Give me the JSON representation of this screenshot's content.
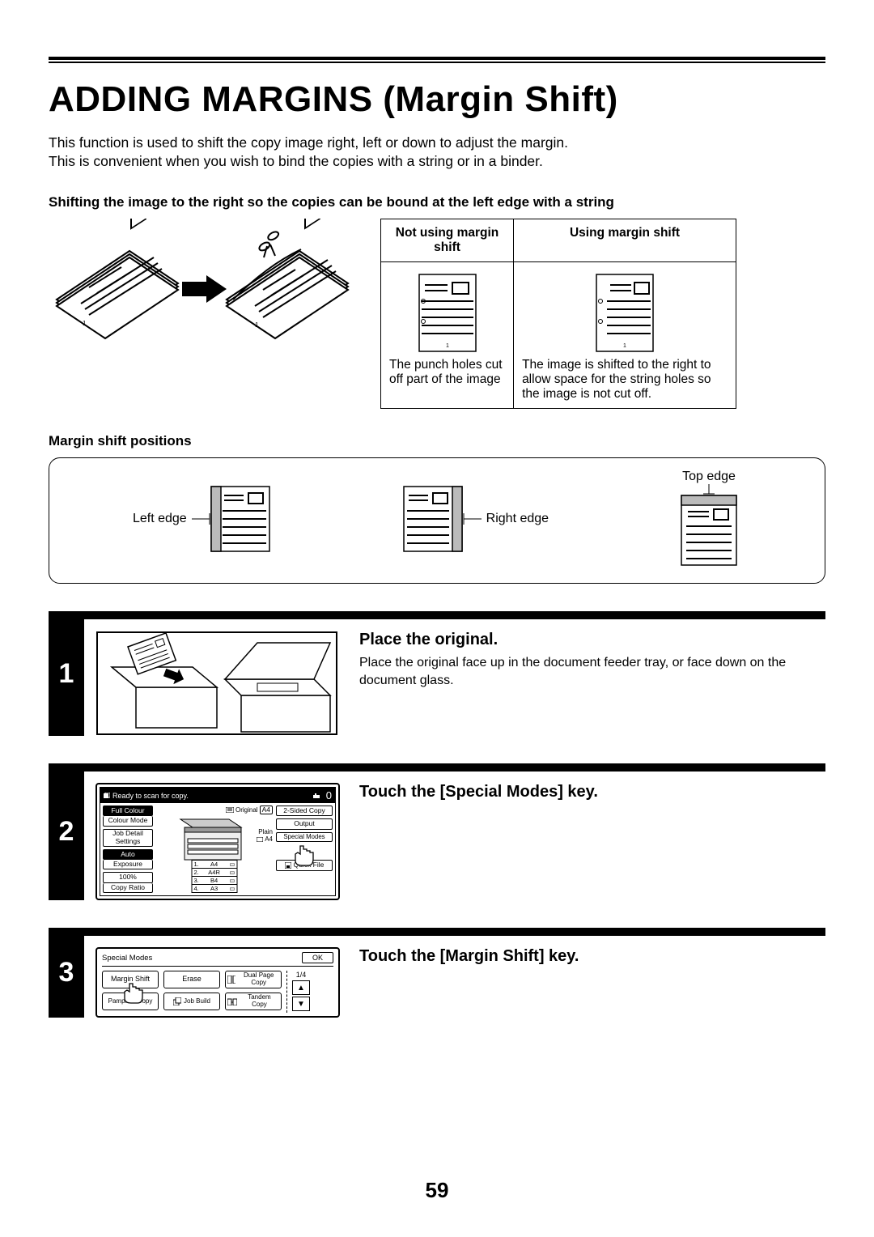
{
  "title": "ADDING MARGINS (Margin Shift)",
  "intro1": "This function is used to shift the copy image right, left or down to adjust the margin.",
  "intro2": "This is convenient when you wish to bind the copies with a string or in a binder.",
  "subhead1": "Shifting the image to the right so the copies can be bound at the left edge with a string",
  "table": {
    "h1": "Not using margin shift",
    "h2": "Using margin shift",
    "c1": "The punch holes cut off part of the image",
    "c2": "The image is shifted to the right to allow space for the string holes so the image is not cut off."
  },
  "pos_heading": "Margin shift positions",
  "pos": {
    "left": "Left edge",
    "right": "Right edge",
    "top": "Top edge"
  },
  "steps": {
    "s1": {
      "num": "1",
      "title": "Place the original.",
      "text": "Place the original face up in the document feeder tray, or face down on the document glass."
    },
    "s2": {
      "num": "2",
      "title": "Touch the [Special Modes] key."
    },
    "s3": {
      "num": "3",
      "title": "Touch the [Margin Shift] key."
    }
  },
  "panel": {
    "status": "Ready to scan for copy.",
    "zero": "0",
    "full_colour": "Full Colour",
    "colour_mode": "Colour Mode",
    "job_detail": "Job Detail Settings",
    "auto": "Auto",
    "exposure": "Exposure",
    "ratio": "100%",
    "copy_ratio": "Copy Ratio",
    "original": "Original",
    "a4": "A4",
    "plain": "Plain",
    "a4_2": "A4",
    "trays": {
      "t1a": "1.",
      "t1b": "A4",
      "t2a": "2.",
      "t2b": "A4R",
      "t3a": "3.",
      "t3b": "B4",
      "t4a": "4.",
      "t4b": "A3"
    },
    "two_sided": "2-Sided Copy",
    "output": "Output",
    "special": "Special Modes",
    "quick_file": "Quick File"
  },
  "sm_panel": {
    "title": "Special Modes",
    "ok": "OK",
    "page": "1/4",
    "margin_shift": "Margin Shift",
    "erase": "Erase",
    "dual_page": "Dual Page Copy",
    "pamphlet": "Pamphlet Copy",
    "job_build": "Job Build",
    "tandem": "Tandem Copy"
  },
  "page_number": "59"
}
